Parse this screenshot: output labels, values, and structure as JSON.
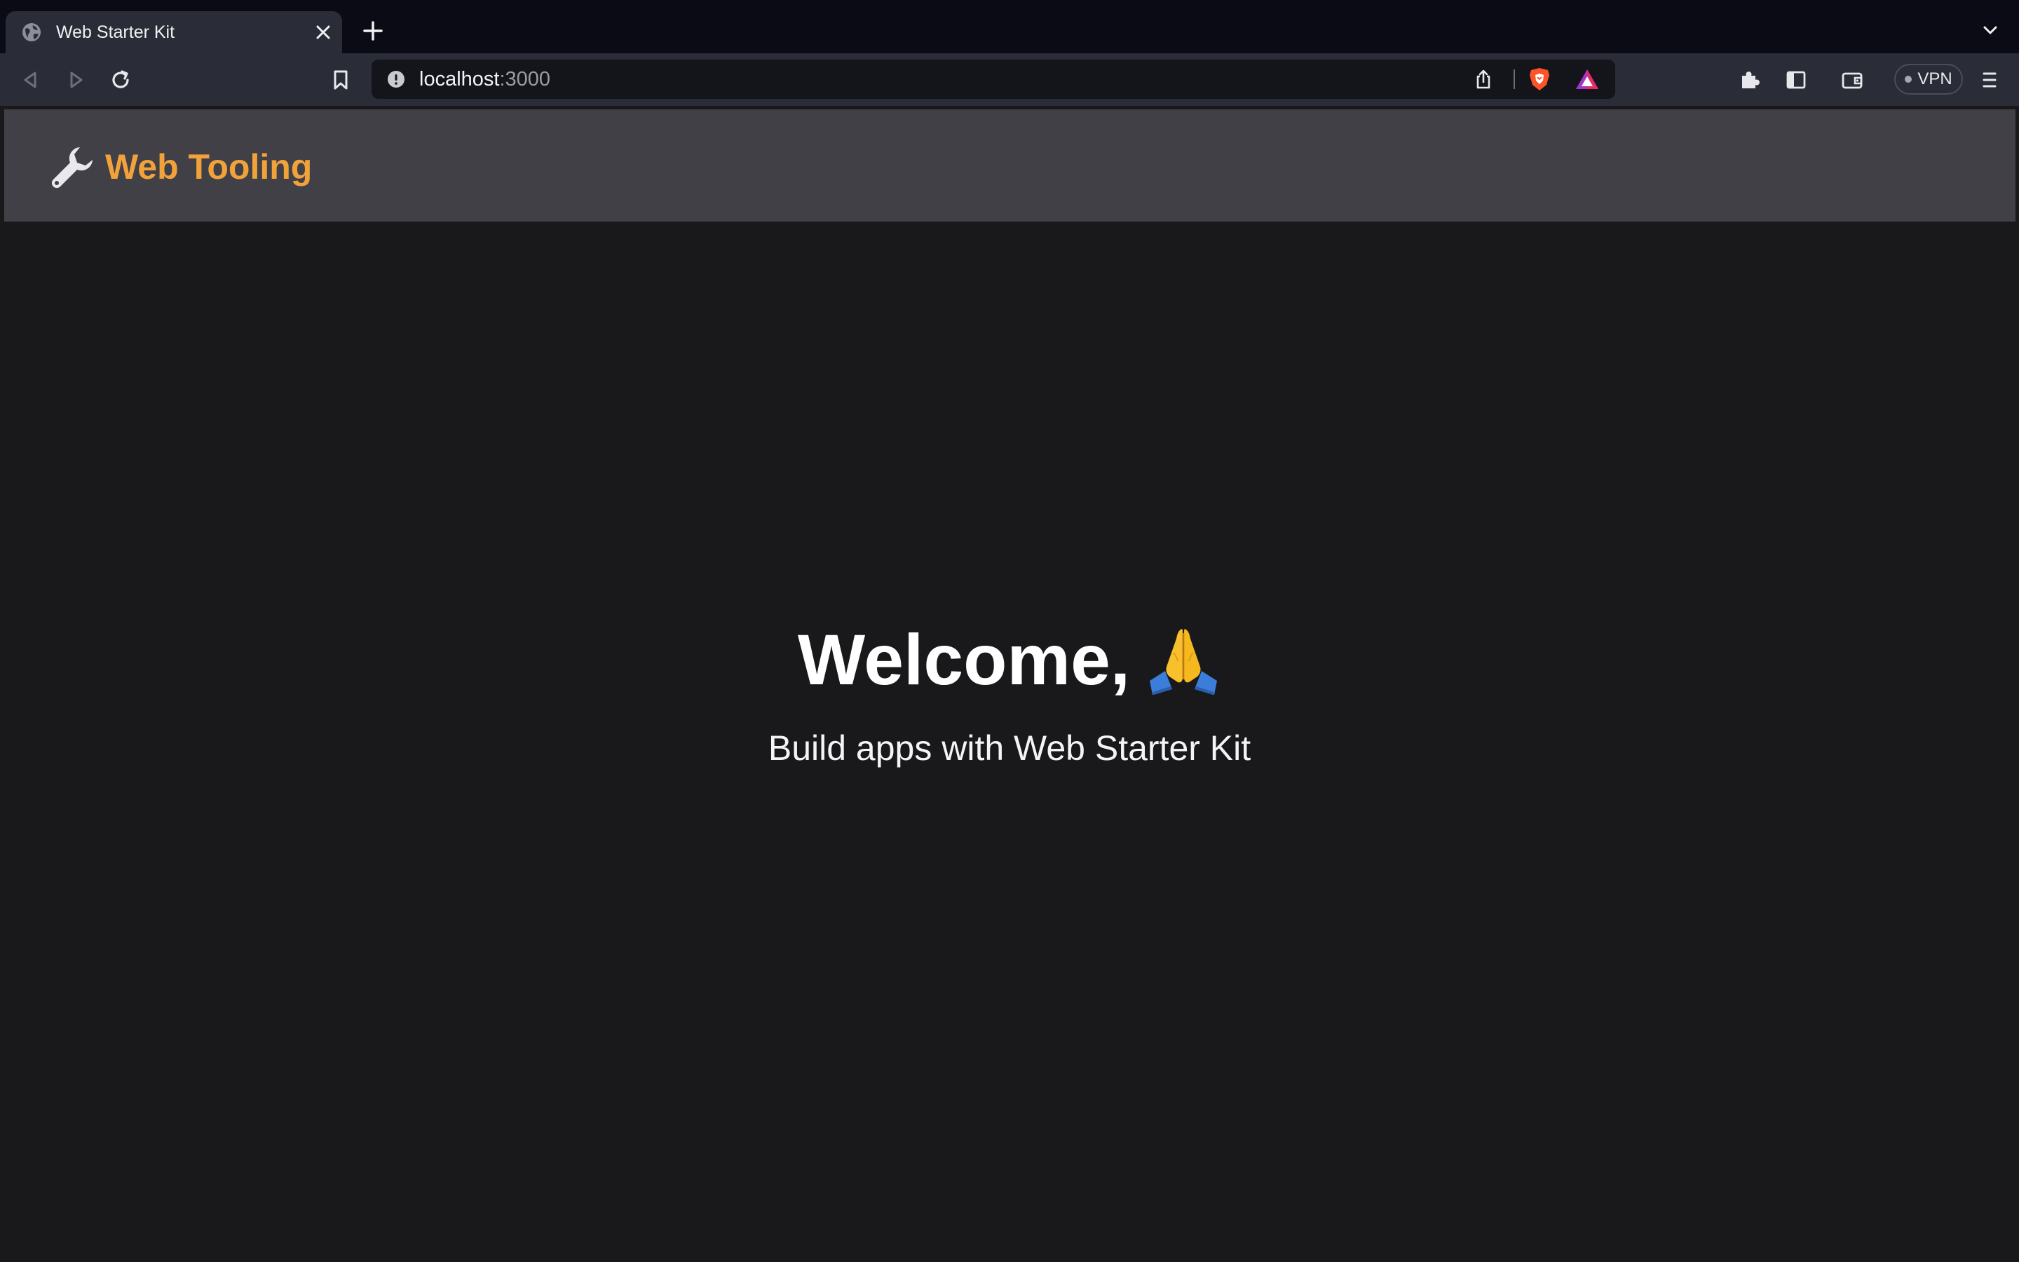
{
  "browser": {
    "tab": {
      "title": "Web Starter Kit",
      "favicon": "globe-icon"
    },
    "address_bar": {
      "host": "localhost",
      "port": ":3000"
    },
    "vpn_label": "VPN",
    "icons": {
      "back": "back-icon",
      "forward": "forward-icon",
      "reload": "reload-icon",
      "bookmark": "bookmark-icon",
      "share": "share-icon",
      "brave_shields": "brave-shields-icon",
      "rewards": "brave-rewards-icon",
      "extensions": "puzzle-icon",
      "sidebar": "sidebar-icon",
      "wallet": "wallet-icon",
      "menu": "hamburger-menu-icon"
    }
  },
  "page": {
    "header": {
      "brand_label": "Web Tooling",
      "brand_icon": "wrench-icon"
    },
    "hero": {
      "title": "Welcome,",
      "title_icon": "folded-hands-icon",
      "subtitle": "Build apps with Web Starter Kit"
    }
  },
  "colors": {
    "page_background": "#19191b",
    "header_background": "#404046",
    "brand_accent": "#f2a23a",
    "browser_chrome": "#2a2d37",
    "tabstrip": "#0b0b15"
  }
}
